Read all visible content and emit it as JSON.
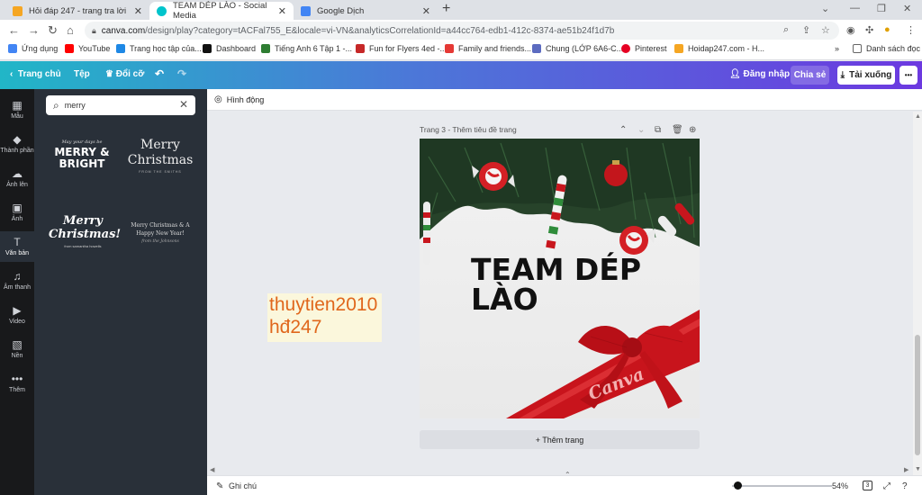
{
  "browser": {
    "tabs": [
      {
        "title": "Hỏi đáp 247 - trang tra lời",
        "fav_color": "#f5a623"
      },
      {
        "title": "TEAM DÉP LÀO - Social Media",
        "fav_color": "#00c4cc"
      },
      {
        "title": "Google Dịch",
        "fav_color": "#4285f4"
      }
    ],
    "new_tab": "+",
    "url_host": "canva.com",
    "url_path": "/design/play?category=tACFal755_E&locale=vi-VN&analyticsCorrelationId=a44cc764-edb1-412c-8374-ae51b24f1d7b",
    "bookmarks": [
      {
        "label": "Ứng dụng",
        "color": "#4285f4"
      },
      {
        "label": "YouTube",
        "color": "#ff0000"
      },
      {
        "label": "Trang học tập của...",
        "color": "#1e88e5"
      },
      {
        "label": "Dashboard",
        "color": "#111111"
      },
      {
        "label": "Tiếng Anh 6 Tập 1 -...",
        "color": "#2e7d32"
      },
      {
        "label": "Fun for Flyers 4ed -...",
        "color": "#c62828"
      },
      {
        "label": "Family and friends...",
        "color": "#e53935"
      },
      {
        "label": "Chung (LỚP 6A6-C...",
        "color": "#5c6bc0"
      },
      {
        "label": "Pinterest",
        "color": "#e60023"
      },
      {
        "label": "Hoidap247.com - H...",
        "color": "#f5a623"
      }
    ],
    "more_bookmarks": "»",
    "reading_list": "Danh sách đọc"
  },
  "canva": {
    "home": "Trang chủ",
    "file": "Tệp",
    "resize": "Đổi cỡ",
    "login": "Đăng nhập",
    "share": "Chia sẻ",
    "download": "Tải xuống",
    "more": "•••",
    "animate": "Hình động",
    "rail": [
      {
        "label": "Mẫu",
        "icon": "▦"
      },
      {
        "label": "Thành phần",
        "icon": "◆"
      },
      {
        "label": "Ảnh lên",
        "icon": "☁"
      },
      {
        "label": "Ảnh",
        "icon": "▣"
      },
      {
        "label": "Văn bản",
        "icon": "T"
      },
      {
        "label": "Âm thanh",
        "icon": "♫"
      },
      {
        "label": "Video",
        "icon": "▶"
      },
      {
        "label": "Nền",
        "icon": "▧"
      },
      {
        "label": "Thêm",
        "icon": "•••"
      }
    ],
    "search_value": "merry",
    "text_templates": [
      {
        "small": "May your days be",
        "big": "MERRY & BRIGHT"
      },
      {
        "big": "Merry Christmas",
        "small": "FROM THE SMITHS"
      },
      {
        "big": "Merry Christmas!",
        "small": "from samantha howells"
      },
      {
        "big": "Merry Christmas & A Happy New Year!",
        "small": "from the Johnsons"
      }
    ],
    "page_title": "Trang 3 - Thêm tiêu đề trang",
    "headline_line1": "TEAM DÉP",
    "headline_line2": "LÀO",
    "ribbon_logo": "Canva",
    "add_page": "+ Thêm trang",
    "notes": "Ghi chú",
    "zoom": "54%",
    "page_count": "3",
    "watermark_line1": "thuytien2010",
    "watermark_line2": "hđ247"
  }
}
